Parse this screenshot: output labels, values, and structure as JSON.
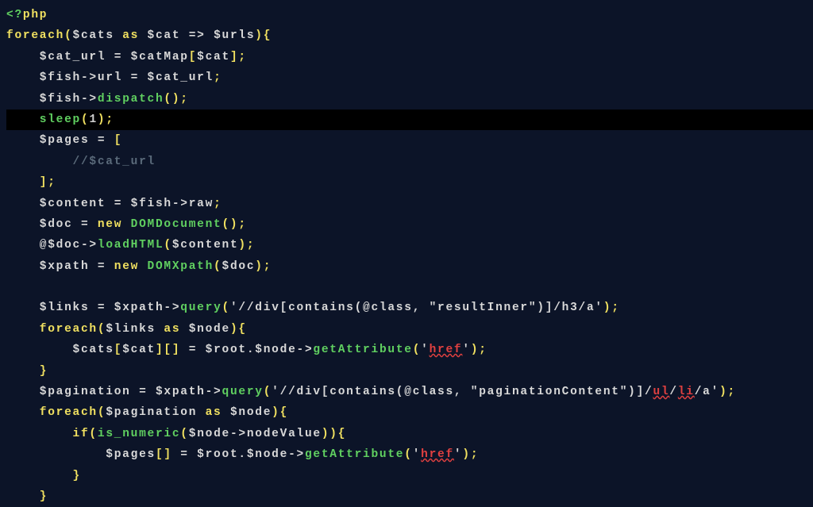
{
  "code": {
    "l1": {
      "open": "<?",
      "php": "php"
    },
    "l2": {
      "foreach": "foreach",
      "p1": "(",
      "v1": "$cats",
      "as": " as ",
      "v2": "$cat",
      "arrow": " => ",
      "v3": "$urls",
      "p2": ")",
      "brace": "{"
    },
    "l3": {
      "ind": "    ",
      "v1": "$cat_url",
      "eq": " = ",
      "v2": "$catMap",
      "br1": "[",
      "v3": "$cat",
      "br2": "]",
      "semi": ";"
    },
    "l4": {
      "ind": "    ",
      "v1": "$fish",
      "arr": "->",
      "prop": "url",
      "eq": " = ",
      "v2": "$cat_url",
      "semi": ";"
    },
    "l5": {
      "ind": "    ",
      "v1": "$fish",
      "arr": "->",
      "fn": "dispatch",
      "p": "()",
      "semi": ";"
    },
    "l6": {
      "ind": "    ",
      "fn": "sleep",
      "p1": "(",
      "n": "1",
      "p2": ")",
      "semi": ";"
    },
    "l7": {
      "ind": "    ",
      "v1": "$pages",
      "eq": " = ",
      "br": "["
    },
    "l8": {
      "ind": "        ",
      "cm": "//$cat_url"
    },
    "l9": {
      "ind": "    ",
      "br": "]",
      "semi": ";"
    },
    "l10": {
      "ind": "    ",
      "v1": "$content",
      "eq": " = ",
      "v2": "$fish",
      "arr": "->",
      "prop": "raw",
      "semi": ";"
    },
    "l11": {
      "ind": "    ",
      "v1": "$doc",
      "eq": " = ",
      "new": "new ",
      "cls": "DOMDocument",
      "p": "()",
      "semi": ";"
    },
    "l12": {
      "ind": "    ",
      "at": "@",
      "v1": "$doc",
      "arr": "->",
      "fn": "loadHTML",
      "p1": "(",
      "v2": "$content",
      "p2": ")",
      "semi": ";"
    },
    "l13": {
      "ind": "    ",
      "v1": "$xpath",
      "eq": " = ",
      "new": "new ",
      "cls": "DOMXpath",
      "p1": "(",
      "v2": "$doc",
      "p2": ")",
      "semi": ";"
    },
    "l14": {
      "blank": " "
    },
    "l15": {
      "ind": "    ",
      "v1": "$links",
      "eq": " = ",
      "v2": "$xpath",
      "arr": "->",
      "fn": "query",
      "p1": "(",
      "sq1": "'",
      "s": "//div[contains(@class, \"resultInner\")]/h3/a",
      "sq2": "'",
      "p2": ")",
      "semi": ";"
    },
    "l16": {
      "ind": "    ",
      "foreach": "foreach",
      "p1": "(",
      "v1": "$links",
      "as": " as ",
      "v2": "$node",
      "p2": ")",
      "brace": "{"
    },
    "l17": {
      "ind": "        ",
      "v1": "$cats",
      "br1": "[",
      "v2": "$cat",
      "br2": "][]",
      "eq": " = ",
      "v3": "$root",
      "dot": ".",
      "v4": "$node",
      "arr": "->",
      "fn": "getAttribute",
      "p1": "(",
      "sq1": "'",
      "s": "href",
      "sq2": "'",
      "p2": ")",
      "semi": ";"
    },
    "l18": {
      "ind": "    ",
      "brace": "}"
    },
    "l19": {
      "ind": "    ",
      "v1": "$pagination",
      "eq": " = ",
      "v2": "$xpath",
      "arr": "->",
      "fn": "query",
      "p1": "(",
      "sq1": "'",
      "s1": "//div[contains(@class, \"paginationContent\")]/",
      "s2": "ul",
      "s3": "/",
      "s4": "li",
      "s5": "/a",
      "sq2": "'",
      "p2": ")",
      "semi": ";"
    },
    "l20": {
      "ind": "    ",
      "foreach": "foreach",
      "p1": "(",
      "v1": "$pagination",
      "as": " as ",
      "v2": "$node",
      "p2": ")",
      "brace": "{"
    },
    "l21": {
      "ind": "        ",
      "if": "if",
      "p1": "(",
      "fn": "is_numeric",
      "p2": "(",
      "v1": "$node",
      "arr": "->",
      "prop": "nodeValue",
      "p3": "))",
      "brace": "{"
    },
    "l22": {
      "ind": "            ",
      "v1": "$pages",
      "br": "[]",
      "eq": " = ",
      "v2": "$root",
      "dot": ".",
      "v3": "$node",
      "arr": "->",
      "fn": "getAttribute",
      "p1": "(",
      "sq1": "'",
      "s": "href",
      "sq2": "'",
      "p2": ")",
      "semi": ";"
    },
    "l23": {
      "ind": "        ",
      "brace": "}"
    },
    "l24": {
      "ind": "    ",
      "brace": "}"
    }
  }
}
